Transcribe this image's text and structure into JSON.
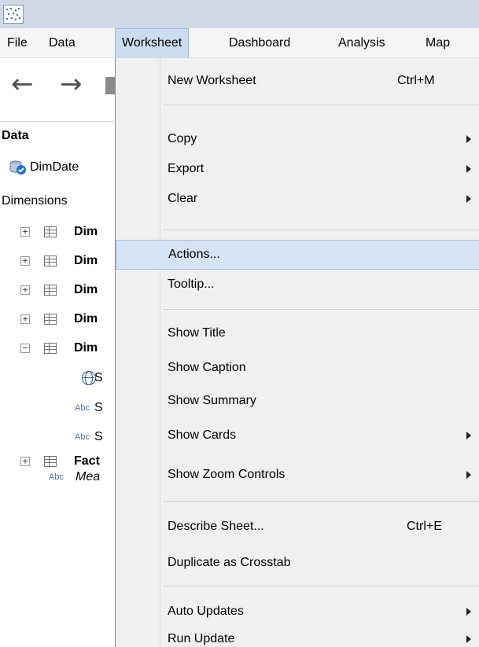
{
  "menubar": {
    "items": [
      "File",
      "Data",
      "Worksheet",
      "Dashboard",
      "Analysis",
      "Map"
    ],
    "active": "Worksheet"
  },
  "toolbar": {
    "back_icon": "arrow-left-icon",
    "forward_icon": "arrow-right-icon"
  },
  "data_pane": {
    "header": "Data",
    "datasource": "DimDate",
    "dimensions_label": "Dimensions",
    "tree": [
      {
        "label": "Dim",
        "expander": "+"
      },
      {
        "label": "Dim",
        "expander": "+"
      },
      {
        "label": "Dim",
        "expander": "+"
      },
      {
        "label": "Dim",
        "expander": "+"
      },
      {
        "label": "Dim",
        "expander": "−"
      }
    ],
    "fields": [
      {
        "type_label": "",
        "icon": "globe-icon",
        "label": "S"
      },
      {
        "type_label": "Abc",
        "label": "S"
      },
      {
        "type_label": "Abc",
        "label": "S"
      }
    ],
    "fact": {
      "label": "Fact",
      "expander": "+"
    },
    "measure": {
      "type_label": "Abc",
      "label": "Mea"
    }
  },
  "dropdown": {
    "items": [
      {
        "label": "New Worksheet",
        "shortcut": "Ctrl+M"
      },
      {
        "label": "Copy",
        "submenu": true
      },
      {
        "label": "Export",
        "submenu": true
      },
      {
        "label": "Clear",
        "submenu": true
      },
      {
        "label": "Actions...",
        "highlighted": true
      },
      {
        "label": "Tooltip..."
      },
      {
        "label": "Show Title"
      },
      {
        "label": "Show Caption"
      },
      {
        "label": "Show Summary"
      },
      {
        "label": "Show Cards",
        "submenu": true
      },
      {
        "label": "Show Zoom Controls",
        "submenu": true
      },
      {
        "label": "Describe Sheet...",
        "shortcut": "Ctrl+E"
      },
      {
        "label": "Duplicate as Crosstab"
      },
      {
        "label": "Auto Updates",
        "submenu": true
      },
      {
        "label": "Run Update",
        "submenu": true
      }
    ]
  }
}
